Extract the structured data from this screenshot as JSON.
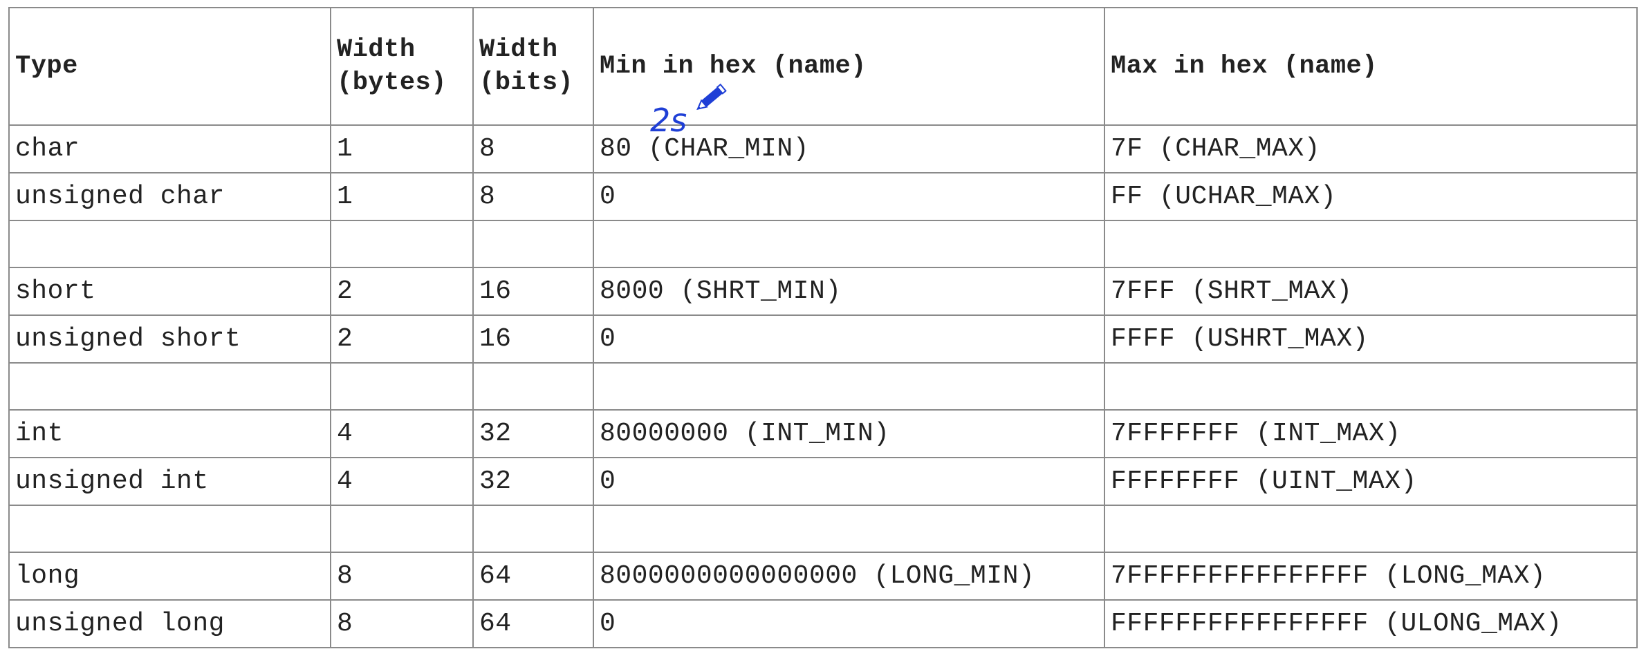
{
  "table": {
    "headers": [
      [
        "Type"
      ],
      [
        "Width",
        "(bytes)"
      ],
      [
        "Width",
        "(bits)"
      ],
      [
        "Min in hex (name)"
      ],
      [
        "Max in hex (name)"
      ]
    ],
    "rows": [
      [
        "char",
        "1",
        "8",
        "80 (CHAR_MIN)",
        "7F (CHAR_MAX)"
      ],
      [
        "unsigned char",
        "1",
        "8",
        "0",
        "FF (UCHAR_MAX)"
      ],
      null,
      [
        "short",
        "2",
        "16",
        "8000 (SHRT_MIN)",
        "7FFF (SHRT_MAX)"
      ],
      [
        "unsigned short",
        "2",
        "16",
        "0",
        "FFFF (USHRT_MAX)"
      ],
      null,
      [
        "int",
        "4",
        "32",
        "80000000 (INT_MIN)",
        "7FFFFFFF (INT_MAX)"
      ],
      [
        "unsigned int",
        "4",
        "32",
        "0",
        "FFFFFFFF (UINT_MAX)"
      ],
      null,
      [
        "long",
        "8",
        "64",
        "8000000000000000 (LONG_MIN)",
        "7FFFFFFFFFFFFFFF (LONG_MAX)"
      ],
      [
        "unsigned long",
        "8",
        "64",
        "0",
        "FFFFFFFFFFFFFFFF (ULONG_MAX)"
      ]
    ]
  },
  "annotation": {
    "text": "2s",
    "color": "#1f3fd6",
    "icon": "pencil-icon"
  }
}
